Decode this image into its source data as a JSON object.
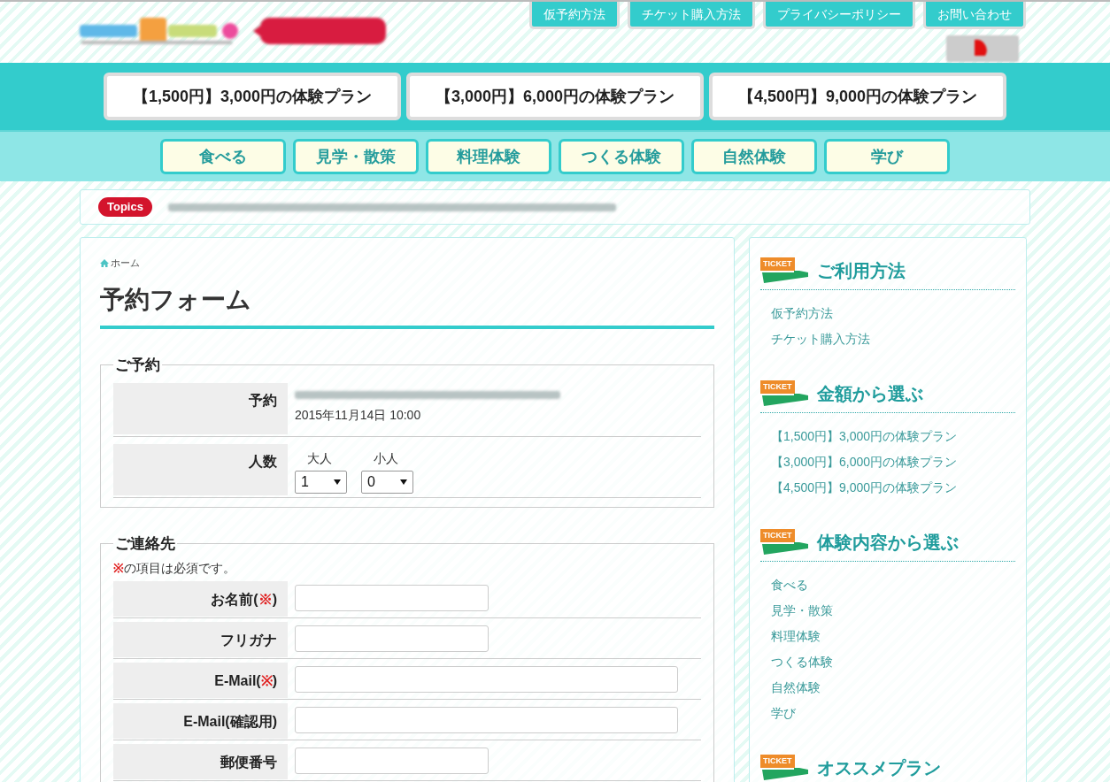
{
  "top_links": [
    {
      "label": "仮予約方法"
    },
    {
      "label": "チケット購入方法"
    },
    {
      "label": "プライバシーポリシー"
    },
    {
      "label": "お問い合わせ"
    }
  ],
  "plan_buttons": [
    {
      "label": "【1,500円】3,000円の体験プラン"
    },
    {
      "label": "【3,000円】6,000円の体験プラン"
    },
    {
      "label": "【4,500円】9,000円の体験プラン"
    }
  ],
  "category_buttons": [
    {
      "label": "食べる"
    },
    {
      "label": "見学・散策"
    },
    {
      "label": "料理体験"
    },
    {
      "label": "つくる体験"
    },
    {
      "label": "自然体験"
    },
    {
      "label": "学び"
    }
  ],
  "topics": {
    "badge": "Topics"
  },
  "breadcrumb": {
    "label": "ホーム"
  },
  "page_title": "予約フォーム",
  "reservation": {
    "legend": "ご予約",
    "rows": [
      {
        "kind": "plan",
        "label": "予約",
        "date": "2015年11月14日 10:00"
      },
      {
        "kind": "people",
        "label": "人数",
        "selects": [
          {
            "label": "大人",
            "value": "1"
          },
          {
            "label": "小人",
            "value": "0"
          }
        ]
      }
    ]
  },
  "contact": {
    "legend": "ご連絡先",
    "note": [
      {
        "text": "※",
        "color": "#e02020"
      },
      {
        "text": "の項目は必須です。"
      }
    ],
    "rows": [
      {
        "label": [
          {
            "text": "お名前("
          },
          {
            "text": "※",
            "color": "#e02020"
          },
          {
            "text": ")"
          }
        ],
        "kind": "short"
      },
      {
        "label": [
          {
            "text": "フリガナ"
          }
        ],
        "kind": "short"
      },
      {
        "label": [
          {
            "text": "E-Mail("
          },
          {
            "text": "※",
            "color": "#e02020"
          },
          {
            "text": ")"
          }
        ],
        "kind": "long"
      },
      {
        "label": [
          {
            "text": "E-Mail(確認用)"
          }
        ],
        "kind": "long"
      },
      {
        "label": [
          {
            "text": "郵便番号"
          }
        ],
        "kind": "short"
      }
    ]
  },
  "sidebar": [
    {
      "badge": "TICKET",
      "title": "ご利用方法",
      "links": [
        "仮予約方法",
        "チケット購入方法"
      ]
    },
    {
      "badge": "TICKET",
      "title": "金額から選ぶ",
      "links": [
        "【1,500円】3,000円の体験プラン",
        "【3,000円】6,000円の体験プラン",
        "【4,500円】9,000円の体験プラン"
      ]
    },
    {
      "badge": "TICKET",
      "title": "体験内容から選ぶ",
      "links": [
        "食べる",
        "見学・散策",
        "料理体験",
        "つくる体験",
        "自然体験",
        "学び"
      ]
    },
    {
      "badge": "TICKET",
      "title": "オススメプラン"
    }
  ]
}
